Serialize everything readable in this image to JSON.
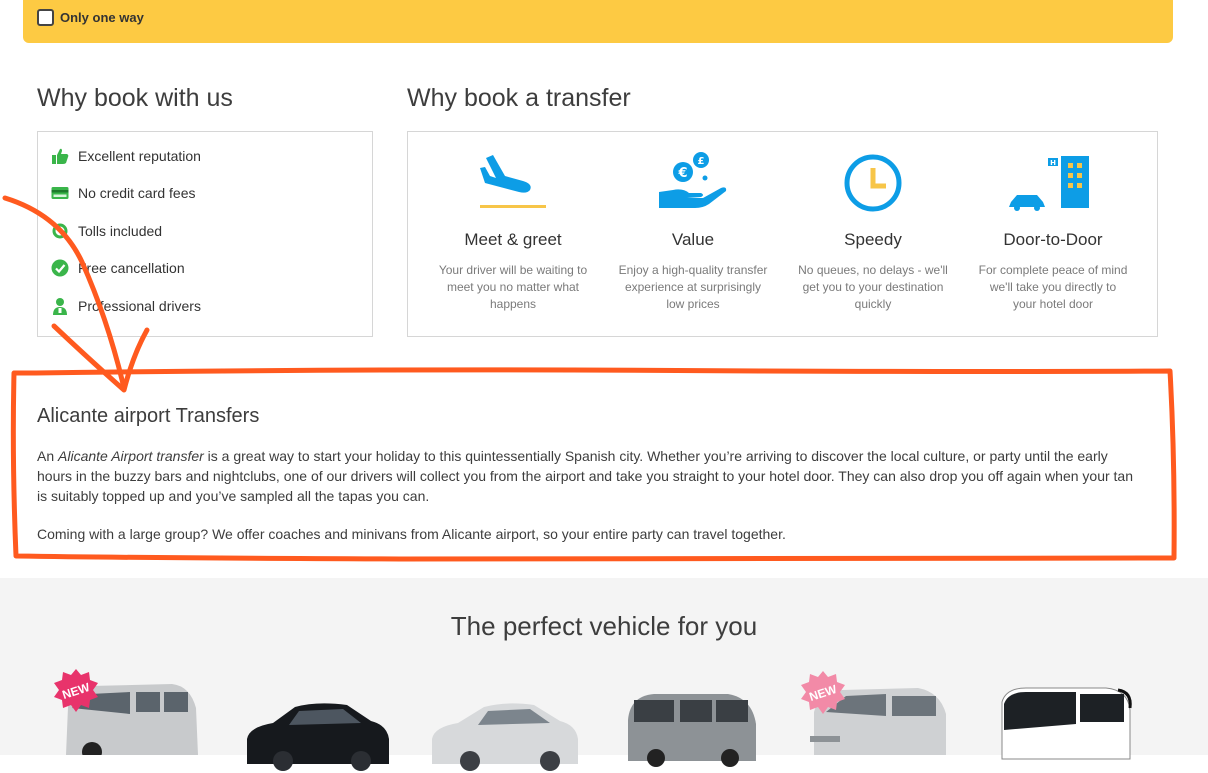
{
  "top_bar": {
    "checkbox_label": "Only one way",
    "checked": false
  },
  "why_book": {
    "title": "Why book with us",
    "items": [
      {
        "label": "Excellent reputation",
        "icon": "thumbs-up-icon"
      },
      {
        "label": "No credit card fees",
        "icon": "credit-card-icon"
      },
      {
        "label": "Tolls included",
        "icon": "toll-icon"
      },
      {
        "label": "Free cancellation",
        "icon": "check-circle-icon"
      },
      {
        "label": "Professional drivers",
        "icon": "driver-icon"
      }
    ]
  },
  "why_transfer": {
    "title": "Why book a transfer",
    "features": [
      {
        "title": "Meet & greet",
        "desc": "Your driver will be waiting to meet you no matter what happens",
        "icon": "plane-landing-icon"
      },
      {
        "title": "Value",
        "desc": "Enjoy a high-quality transfer experience at surprisingly low prices",
        "icon": "money-hand-icon"
      },
      {
        "title": "Speedy",
        "desc": "No queues, no delays - we'll get you to your destination quickly",
        "icon": "clock-icon"
      },
      {
        "title": "Door-to-Door",
        "desc": "For complete peace of mind we'll take you directly to your hotel door",
        "icon": "hotel-car-icon"
      }
    ]
  },
  "airport": {
    "title": "Alicante airport Transfers",
    "p1_before": "An ",
    "p1_em": "Alicante Airport transfer",
    "p1_after": " is a great way to start your holiday to this quintessentially Spanish city. Whether you’re arriving to discover the local culture, or party until the early hours in the buzzy bars and nightclubs, one of our drivers will collect you from the airport and take you straight to your hotel door. They can also drop you off again when your tan is suitably topped up and you’ve sampled all the tapas you can.",
    "p2": "Coming with a large group? We offer coaches and minivans from Alicante airport, so your entire party can travel together."
  },
  "vehicles": {
    "title": "The perfect vehicle for you",
    "badge_label": "NEW",
    "items": [
      {
        "name": "minibus",
        "new": true
      },
      {
        "name": "black-sedan",
        "new": false
      },
      {
        "name": "silver-sedan",
        "new": false
      },
      {
        "name": "minivan",
        "new": false
      },
      {
        "name": "accessible-van",
        "new": true
      },
      {
        "name": "coach-bus",
        "new": false
      }
    ]
  },
  "colors": {
    "brand_yellow": "#fdca43",
    "icon_blue": "#0d9de6",
    "icon_green": "#3ab54a",
    "badge_pink": "#e8336b",
    "annotation_orange": "#ff5a1f"
  }
}
